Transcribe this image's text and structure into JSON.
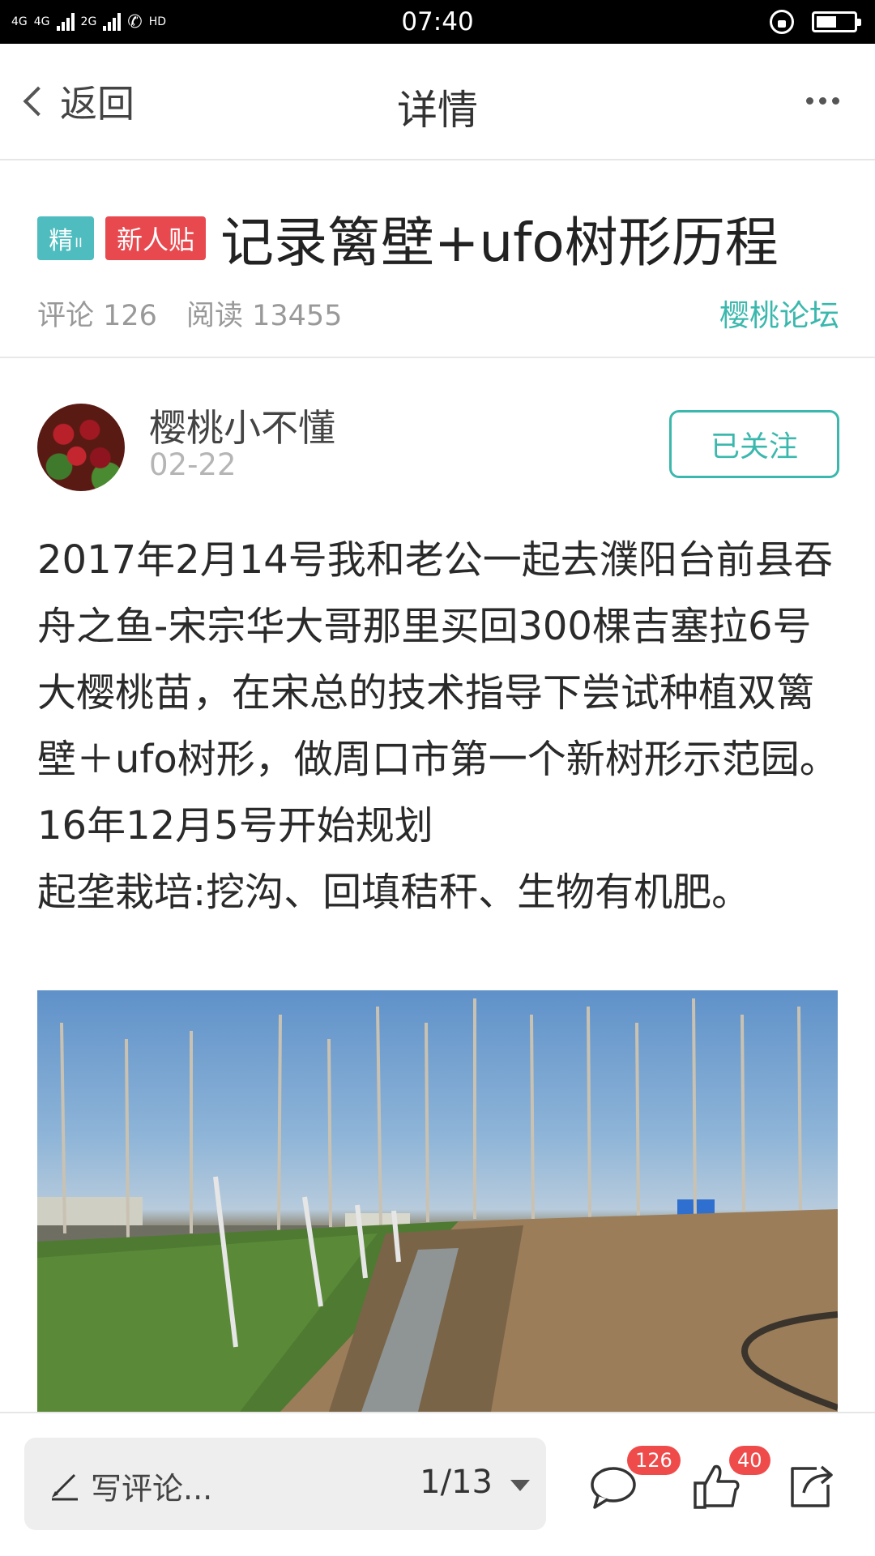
{
  "status_bar": {
    "network_1": "4G",
    "network_2": "4G",
    "network_3": "2G",
    "hd": "HD",
    "time": "07:40",
    "battery_level": 0.55
  },
  "nav": {
    "back_label": "返回",
    "title": "详情"
  },
  "post": {
    "badge_jing": "精",
    "badge_jing_sub": "II",
    "badge_new": "新人贴",
    "title": "记录篱壁+ufo树形历程",
    "comments_label": "评论 126",
    "reads_label": "阅读 13455",
    "forum": "樱桃论坛"
  },
  "author": {
    "name": "樱桃小不懂",
    "date": "02-22",
    "follow_label": "已关注"
  },
  "body": {
    "para1": "2017年2月14号我和老公一起去濮阳台前县吞舟之鱼-宋宗华大哥那里买回300棵吉塞拉6号大樱桃苗，在宋总的技术指导下尝试种植双篱壁＋ufo树形，做周口市第一个新树形示范园。",
    "para2": "16年12月5号开始规划",
    "para3": "起垄栽培:挖沟、回填秸秆、生物有机肥。"
  },
  "bottom_bar": {
    "comment_placeholder": "写评论...",
    "page_indicator": "1/13",
    "comment_count": "126",
    "like_count": "40"
  },
  "icons": {
    "back": "chevron-left-icon",
    "more": "more-dots-icon",
    "pen": "pen-icon",
    "comment": "comment-bubble-icon",
    "like": "thumbs-up-icon",
    "share": "share-icon"
  },
  "colors": {
    "accent": "#3bb8ad",
    "badge_jing": "#4fbdbf",
    "badge_new": "#e8494f",
    "count_badge": "#ef4b4b"
  }
}
